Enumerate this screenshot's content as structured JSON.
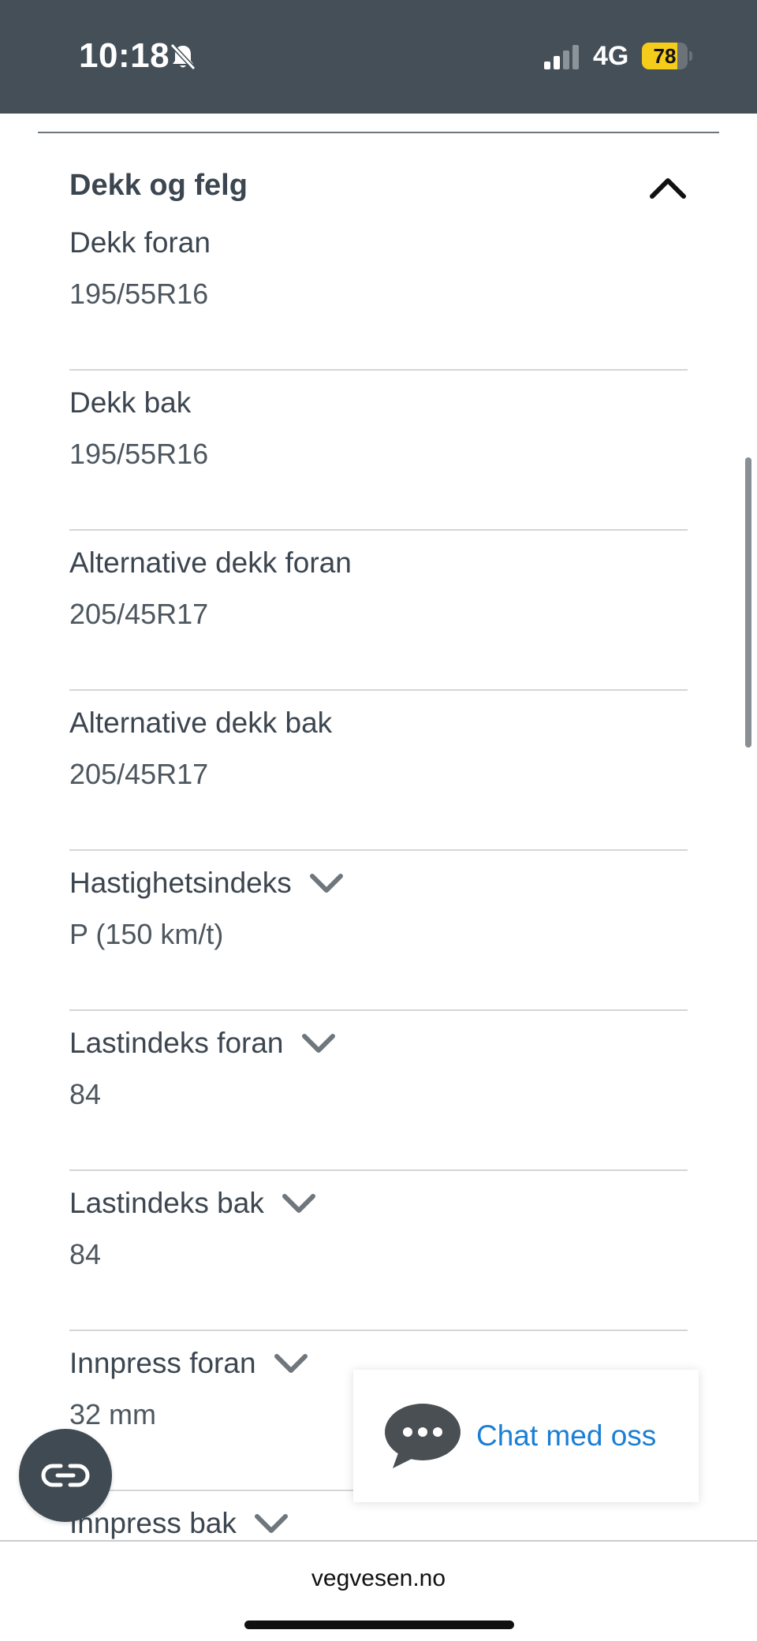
{
  "status_bar": {
    "time": "10:18",
    "network": "4G",
    "battery_level": "78",
    "battery_fraction": 0.78,
    "battery_color": "#f5cc1a"
  },
  "section": {
    "title": "Dekk og felg",
    "icon": "chevron-up-icon"
  },
  "rows": [
    {
      "label": "Dekk foran",
      "value": "195/55R16"
    },
    {
      "label": "Dekk bak",
      "value": "195/55R16"
    },
    {
      "label": "Alternative dekk foran",
      "value": "205/45R17"
    },
    {
      "label": "Alternative dekk bak",
      "value": "205/45R17"
    },
    {
      "label": "Hastighetsindeks",
      "value": "P (150 km/t)",
      "icon": "chevron-down-icon"
    },
    {
      "label": "Lastindeks foran",
      "value": "84",
      "icon": "chevron-down-icon"
    },
    {
      "label": "Lastindeks bak",
      "value": "84",
      "icon": "chevron-down-icon"
    },
    {
      "label": "Innpress foran",
      "value": "32 mm",
      "icon": "chevron-down-icon"
    },
    {
      "label": "Innpress bak",
      "icon": "chevron-down-icon"
    }
  ],
  "chat": {
    "label": "Chat med oss",
    "icon": "chat-bubble-icon"
  },
  "fab": {
    "icon": "link-icon"
  },
  "browser": {
    "url": "vegvesen.no"
  },
  "colors": {
    "status_bar_bg": "#444f58",
    "text": "#3c4650",
    "link": "#1a7fd4"
  }
}
